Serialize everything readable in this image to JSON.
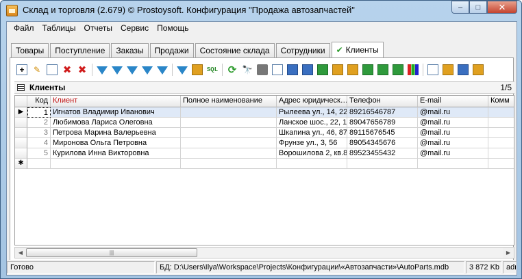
{
  "window": {
    "title": "Склад и торговля (2.679) © Prostoysoft. Конфигурация \"Продажа автозапчастей\"",
    "minimize": "–",
    "maximize": "□",
    "close": "✕"
  },
  "menu": [
    {
      "label": "Файл"
    },
    {
      "label": "Таблицы"
    },
    {
      "label": "Отчеты"
    },
    {
      "label": "Сервис"
    },
    {
      "label": "Помощь"
    }
  ],
  "tabs": [
    {
      "label": "Товары"
    },
    {
      "label": "Поступление"
    },
    {
      "label": "Заказы"
    },
    {
      "label": "Продажи"
    },
    {
      "label": "Состояние склада"
    },
    {
      "label": "Сотрудники"
    },
    {
      "label": "Клиенты",
      "active": true
    }
  ],
  "toolbar_icons": [
    "new-record-icon",
    "edit-icon",
    "copy-icon",
    "delete-icon",
    "delete-all-icon",
    "filter-icon",
    "filter-add-icon",
    "filter-remove-icon",
    "filter-clear-icon",
    "filter-edit-icon",
    "filter-view-icon",
    "group-icon",
    "sql-icon",
    "refresh-icon",
    "find-icon",
    "print-icon",
    "preview-icon",
    "export-doc-icon",
    "export-word-icon",
    "export-xls-icon",
    "export-html-icon",
    "export-image-icon",
    "export-txt-icon",
    "export-csv-icon",
    "export-sheet-icon",
    "chart-icon",
    "list-icon",
    "properties-icon",
    "columns-icon",
    "settings-icon"
  ],
  "grid": {
    "title": "Клиенты",
    "count": "1/5",
    "columns": [
      "Код",
      "Клиент",
      "Полное наименование",
      "Адрес юридическ…",
      "Телефон",
      "E-mail",
      "Комм"
    ],
    "rows": [
      {
        "code": "1",
        "client": "Игнатов Владимир Иванович",
        "full": "",
        "address": "Рылеева ул., 14, 22",
        "phone": "89216546787",
        "email": "@mail.ru",
        "comment": ""
      },
      {
        "code": "2",
        "client": "Любимова Лариса Олеговна",
        "full": "",
        "address": "Ланское шос., 22, 1",
        "phone": "89047656789",
        "email": "@mail.ru",
        "comment": ""
      },
      {
        "code": "3",
        "client": "Петрова Марина Валерьевна",
        "full": "",
        "address": "Шкапина ул., 46, 87",
        "phone": "89115676545",
        "email": "@mail.ru",
        "comment": ""
      },
      {
        "code": "4",
        "client": "Миронова Ольга Петровна",
        "full": "",
        "address": "Фрунзе ул., 3, 56",
        "phone": "89054345676",
        "email": "@mail.ru",
        "comment": ""
      },
      {
        "code": "5",
        "client": "Курилова Инна Викторовна",
        "full": "",
        "address": "Ворошилова 2, кв.8",
        "phone": "89523455432",
        "email": "@mail.ru",
        "comment": ""
      }
    ],
    "current_row_marker": "▶",
    "new_row_marker": "✱"
  },
  "status": {
    "state": "Готово",
    "db_label": "БД:",
    "db_path": "D:\\Users\\Ilya\\Workspace\\Projects\\Конфигурации\\«Автозапчасти»\\AutoParts.mdb",
    "size": "3 872 Kb",
    "user": "admir"
  }
}
